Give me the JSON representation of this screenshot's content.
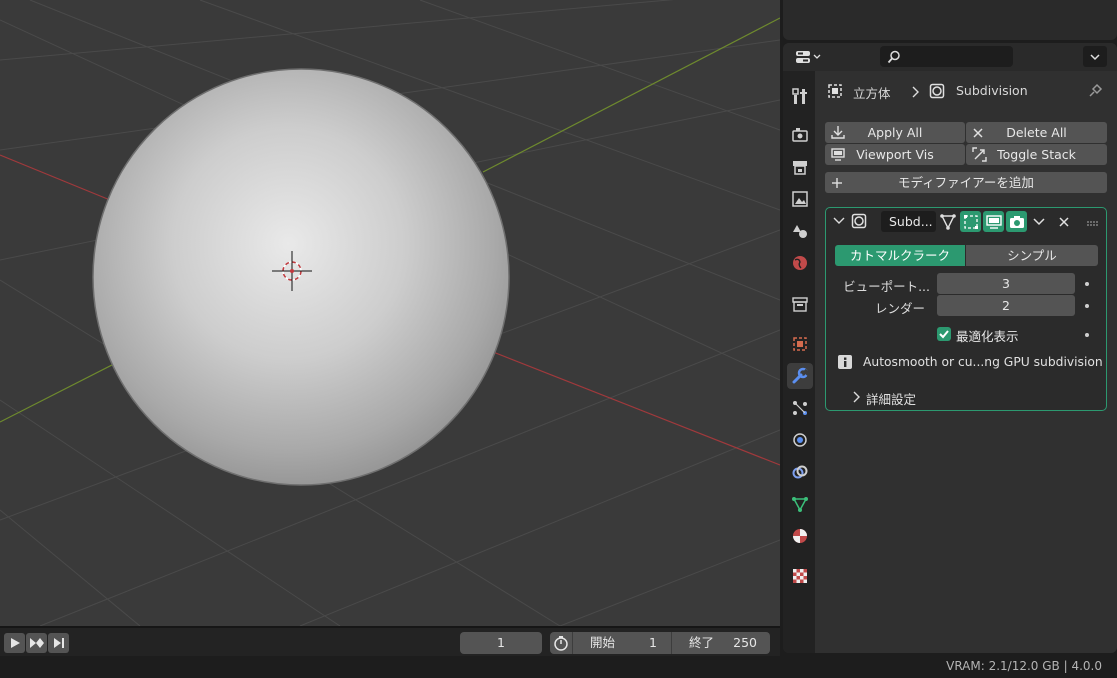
{
  "viewport": {
    "description": "3D viewport with UV sphere"
  },
  "timeline": {
    "current_frame": "1",
    "start_label": "開始",
    "start_value": "1",
    "end_label": "終了",
    "end_value": "250"
  },
  "status": {
    "text": "VRAM: 2.1/12.0 GB | 4.0.0"
  },
  "properties": {
    "search_placeholder": "",
    "breadcrumb": {
      "object": "立方体",
      "modifier": "Subdivision"
    },
    "toolbar": {
      "apply_all": "Apply All",
      "delete_all": "Delete All",
      "viewport_vis": "Viewport Vis",
      "toggle_stack": "Toggle Stack",
      "add_modifier": "モディファイアーを追加"
    },
    "modifier": {
      "name": "Subd...",
      "type_catmull": "カトマルクラーク",
      "type_simple": "シンプル",
      "viewport_label": "ビューポート...",
      "viewport_value": "3",
      "render_label": "レンダー",
      "render_value": "2",
      "optimal_display": "最適化表示",
      "info_text": "Autosmooth or cu...ng GPU subdivision",
      "advanced": "詳細設定"
    },
    "accent_color": "#2c9970"
  }
}
